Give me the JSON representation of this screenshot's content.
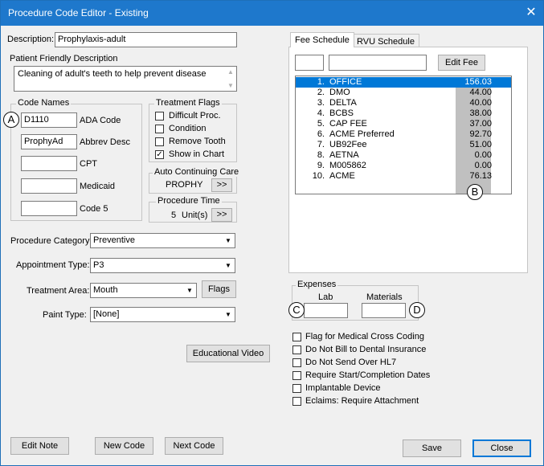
{
  "window": {
    "title": "Procedure Code Editor - Existing",
    "close_glyph": "✕"
  },
  "description": {
    "label": "Description:",
    "value": "Prophylaxis-adult"
  },
  "patient_friendly": {
    "label": "Patient Friendly Description",
    "value": "Cleaning of adult's teeth to help prevent disease"
  },
  "code_names": {
    "title": "Code Names",
    "rows": [
      {
        "value": "D1110",
        "label": "ADA Code"
      },
      {
        "value": "ProphyAd",
        "label": "Abbrev Desc"
      },
      {
        "value": "",
        "label": "CPT"
      },
      {
        "value": "",
        "label": "Medicaid"
      },
      {
        "value": "",
        "label": "Code 5"
      }
    ]
  },
  "treatment_flags": {
    "title": "Treatment Flags",
    "items": [
      {
        "label": "Difficult Proc.",
        "checked": false
      },
      {
        "label": "Condition",
        "checked": false
      },
      {
        "label": "Remove Tooth",
        "checked": false
      },
      {
        "label": "Show in Chart",
        "checked": true
      }
    ]
  },
  "auto_care": {
    "title": "Auto Continuing Care",
    "value": "PROPHY",
    "button": ">>"
  },
  "procedure_time": {
    "title": "Procedure Time",
    "value": "5",
    "unit": "Unit(s)",
    "button": ">>"
  },
  "form": {
    "procedure_category": {
      "label": "Procedure Category:",
      "value": "Preventive"
    },
    "appointment_type": {
      "label": "Appointment Type:",
      "value": "P3"
    },
    "treatment_area": {
      "label": "Treatment Area:",
      "value": "Mouth",
      "flags_button": "Flags"
    },
    "paint_type": {
      "label": "Paint Type:",
      "value": "[None]"
    }
  },
  "educational_video": "Educational Video",
  "tabs": [
    "Fee Schedule",
    "RVU Schedule"
  ],
  "edit_fee": "Edit Fee",
  "fees": [
    {
      "num": "1.",
      "name": "OFFICE",
      "amount": "156.03"
    },
    {
      "num": "2.",
      "name": "DMO",
      "amount": "44.00"
    },
    {
      "num": "3.",
      "name": "DELTA",
      "amount": "40.00"
    },
    {
      "num": "4.",
      "name": "BCBS",
      "amount": "38.00"
    },
    {
      "num": "5.",
      "name": "CAP FEE",
      "amount": "37.00"
    },
    {
      "num": "6.",
      "name": "ACME Preferred",
      "amount": "92.70"
    },
    {
      "num": "7.",
      "name": "UB92Fee",
      "amount": "51.00"
    },
    {
      "num": "8.",
      "name": "AETNA",
      "amount": "0.00"
    },
    {
      "num": "9.",
      "name": "M005862",
      "amount": "0.00"
    },
    {
      "num": "10.",
      "name": "ACME",
      "amount": "76.13"
    }
  ],
  "expenses": {
    "title": "Expenses",
    "lab": "Lab",
    "materials": "Materials"
  },
  "options": [
    "Flag for Medical Cross Coding",
    "Do Not Bill to Dental Insurance",
    "Do Not Send Over HL7",
    "Require Start/Completion Dates",
    "Implantable Device",
    "Eclaims: Require Attachment"
  ],
  "callouts": {
    "a": "A",
    "b": "B",
    "c": "C",
    "d": "D"
  },
  "buttons": {
    "edit_note": "Edit Note",
    "new_code": "New Code",
    "next_code": "Next Code",
    "save": "Save",
    "close": "Close"
  },
  "colors": {
    "titlebar": "#1e78cc",
    "selection": "#0078d7",
    "amount_column": "#c0c0c0"
  }
}
